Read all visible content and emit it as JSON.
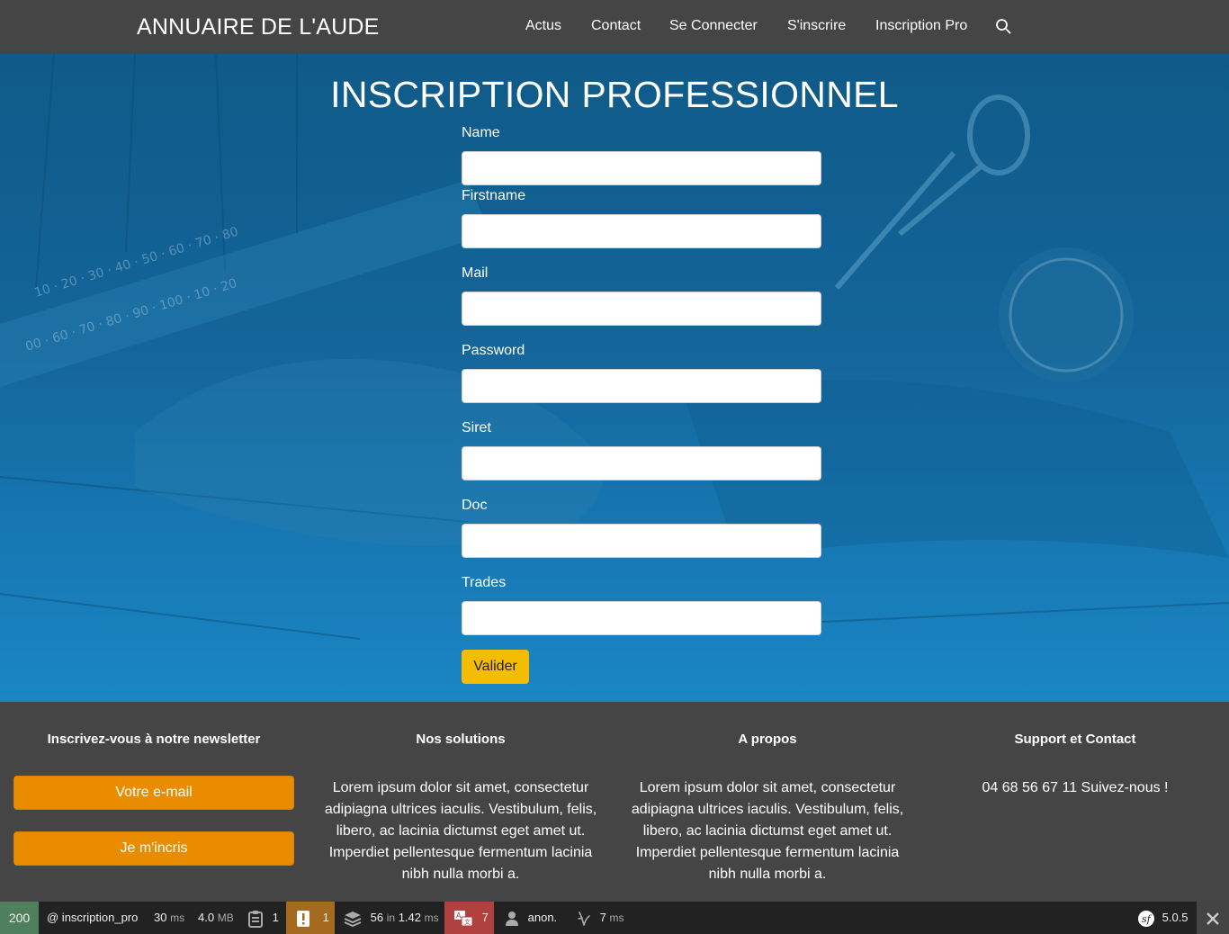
{
  "navbar": {
    "brand": "ANNUAIRE DE L'AUDE",
    "links": [
      "Actus",
      "Contact",
      "Se Connecter",
      "S'inscrire",
      "Inscription Pro"
    ]
  },
  "page": {
    "title": "INSCRIPTION PROFESSIONNEL"
  },
  "form": {
    "fields": [
      {
        "label": "Name",
        "value": ""
      },
      {
        "label": "Firstname",
        "value": ""
      },
      {
        "label": "Mail",
        "value": ""
      },
      {
        "label": "Password",
        "value": ""
      },
      {
        "label": "Siret",
        "value": ""
      },
      {
        "label": "Doc",
        "value": ""
      },
      {
        "label": "Trades",
        "value": ""
      }
    ],
    "submit_label": "Valider"
  },
  "footer": {
    "newsletter_title": "Inscrivez-vous à notre newsletter",
    "email_button": "Votre e-mail",
    "subscribe_button": "Je m'incris",
    "solutions_title": "Nos solutions",
    "solutions_text": "Lorem ipsum dolor sit amet, consectetur adipiagna ultrices iaculis. Vestibulum, felis, libero, ac lacinia dictumst eget amet ut. Imperdiet pellentesque fermentum lacinia nibh nulla morbi a.",
    "about_title": "A propos",
    "about_text": "Lorem ipsum dolor sit amet, consectetur adipiagna ultrices iaculis. Vestibulum, felis, libero, ac lacinia dictumst eget amet ut. Imperdiet pellentesque fermentum lacinia nibh nulla morbi a.",
    "support_title": "Support et Contact",
    "support_text": "04 68 56 67 11 Suivez-nous !"
  },
  "toolbar": {
    "status_code": "200",
    "route": "@ inscription_pro",
    "time_value": "30",
    "time_unit": "ms",
    "memory_value": "4.0",
    "memory_unit": "MB",
    "forms_count": "1",
    "logs_count": "1",
    "queries_count": "56",
    "queries_in": "in",
    "queries_time": "1.42",
    "queries_unit": "ms",
    "translations_count": "7",
    "user": "anon.",
    "twig_time": "7",
    "twig_unit": "ms",
    "version": "5.0.5",
    "colors": {
      "status_ok": "#4f805d",
      "logs_warning": "#a46a1f",
      "translations_error": "#b0413e",
      "background": "#222222"
    }
  },
  "colors": {
    "navbar": "#454545",
    "hero_overlay": "#14659a",
    "submit_button": "#f5bd02",
    "footer_button": "#e98c00"
  }
}
